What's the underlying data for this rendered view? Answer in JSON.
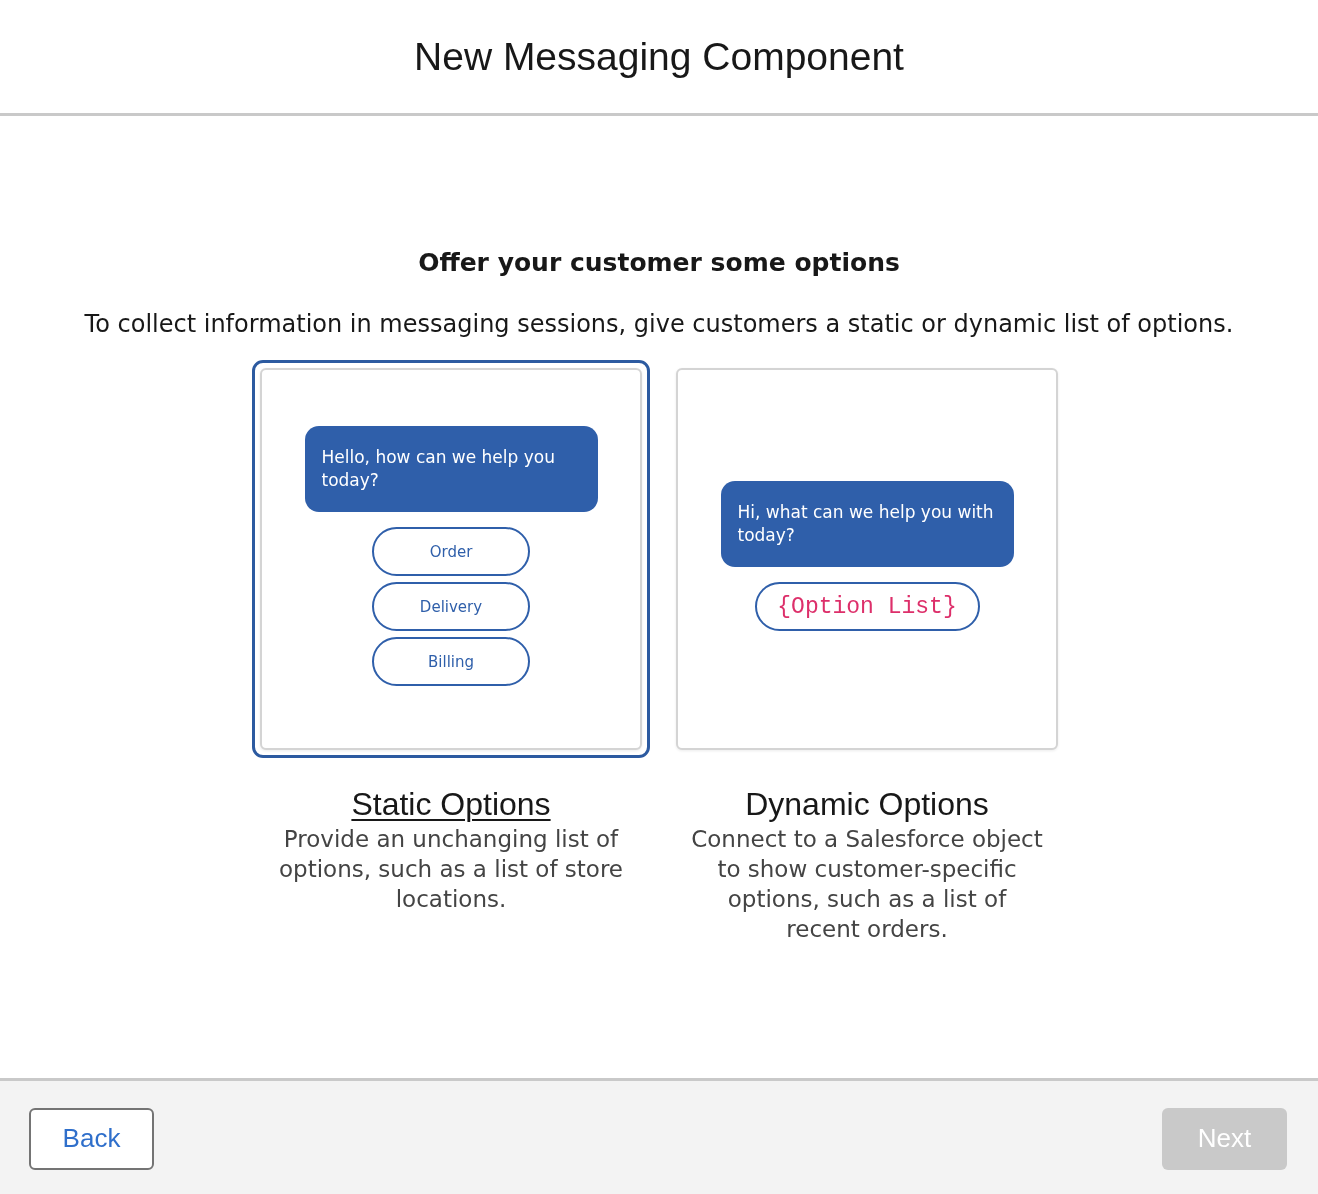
{
  "dialog": {
    "title": "New Messaging Component"
  },
  "heading": "Offer your customer some options",
  "description": "To collect information in messaging sessions, give customers a static or dynamic list of options.",
  "options": [
    {
      "selected": true,
      "title": "Static Options",
      "description": "Provide an unchanging list of options, such as a list of store locations.",
      "preview": {
        "message": "Hello, how can we help you today?",
        "choices": [
          {
            "kind": "option",
            "label": "Order"
          },
          {
            "kind": "option",
            "label": "Delivery"
          },
          {
            "kind": "option",
            "label": "Billing"
          }
        ]
      }
    },
    {
      "selected": false,
      "title": "Dynamic Options",
      "description": "Connect to a Salesforce object to show customer-specific options, such as a list of recent orders.",
      "preview": {
        "message": "Hi, what can we help you with today?",
        "choices": [
          {
            "kind": "token",
            "label": "{Option List}"
          }
        ]
      }
    }
  ],
  "footer": {
    "back": {
      "label": "Back",
      "disabled": false
    },
    "next": {
      "label": "Next",
      "disabled": true
    }
  }
}
